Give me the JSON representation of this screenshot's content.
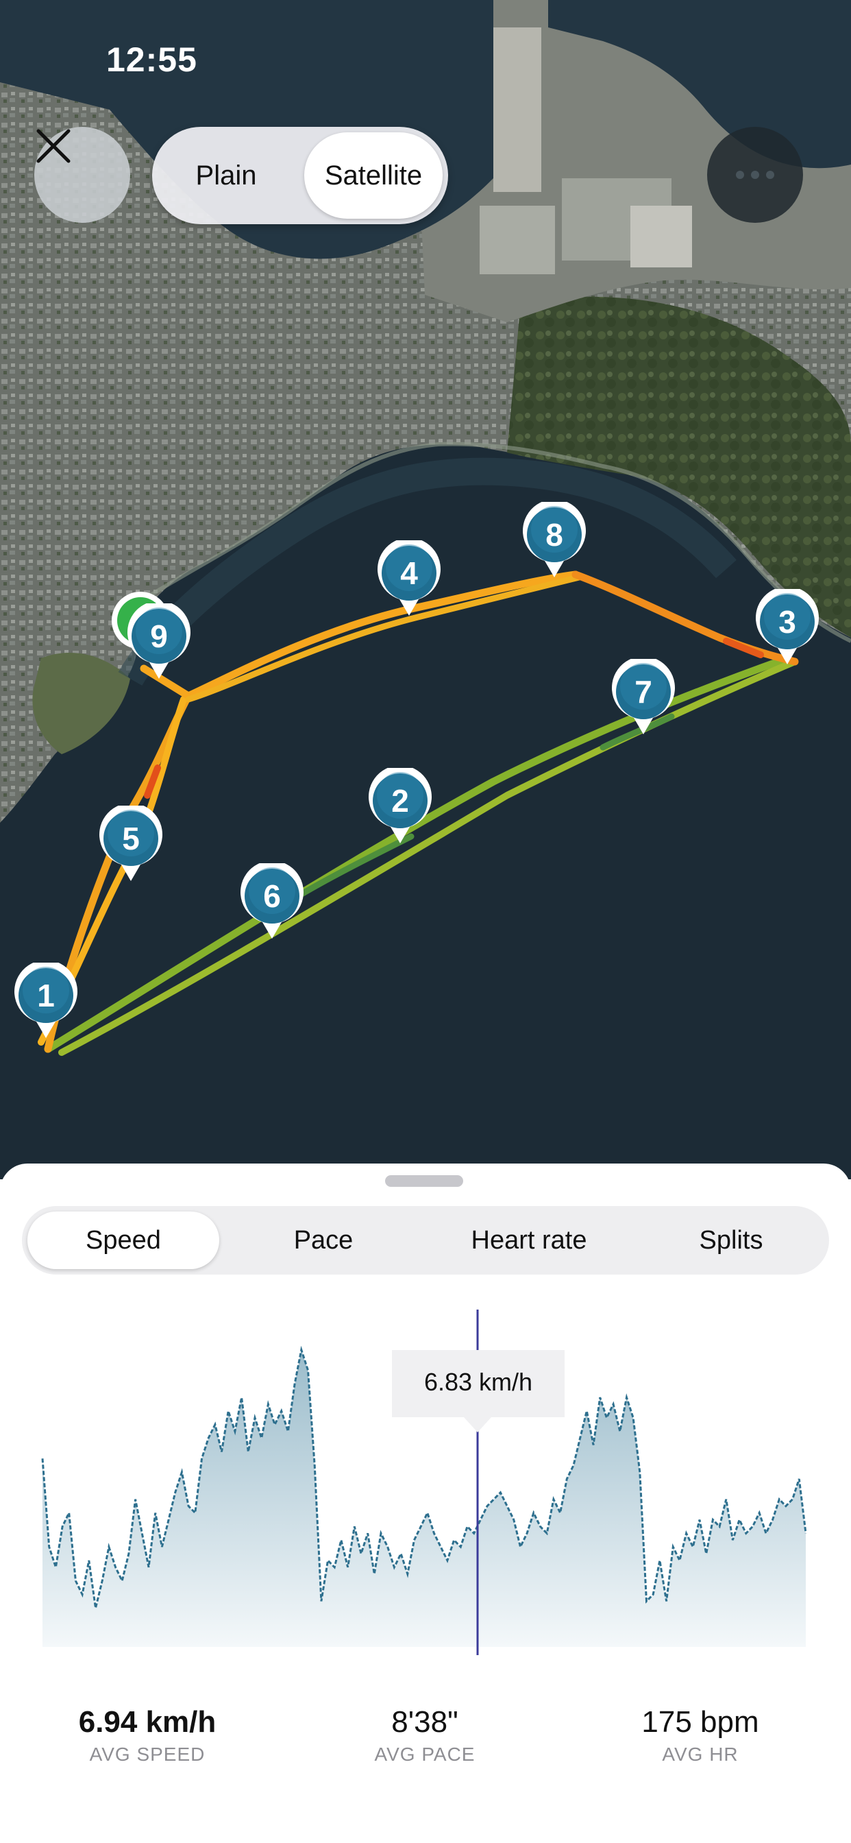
{
  "status_bar": {
    "time": "12:55"
  },
  "map_controls": {
    "close_icon": "close-x-icon",
    "view_toggle": {
      "options": [
        "Plain",
        "Satellite"
      ],
      "selected": "Satellite"
    },
    "more_icon": "more-dots-icon"
  },
  "route_markers": [
    "1",
    "2",
    "3",
    "4",
    "5",
    "6",
    "7",
    "8",
    "9"
  ],
  "tabs": {
    "items": [
      "Speed",
      "Pace",
      "Heart rate",
      "Splits"
    ],
    "selected": "Speed"
  },
  "tooltip": {
    "text": "6.83 km/h"
  },
  "stats": [
    {
      "value": "6.94 km/h",
      "label": "AVG SPEED"
    },
    {
      "value": "8'38\"",
      "label": "AVG PACE"
    },
    {
      "value": "175 bpm",
      "label": "AVG HR"
    }
  ],
  "colors": {
    "series_line": "#2d6f8e",
    "cursor": "#3b3b9a",
    "marker": "#1f6e91",
    "route_fast": "#f5b41e",
    "route_slow": "#8bb82c"
  },
  "chart_data": {
    "type": "area",
    "title": "",
    "xlabel": "",
    "ylabel": "",
    "series": [
      {
        "values": [
          7.5,
          6.2,
          5.9,
          6.5,
          6.7,
          5.7,
          5.5,
          6.0,
          5.3,
          5.7,
          6.2,
          5.9,
          5.7,
          6.1,
          6.9,
          6.4,
          5.9,
          6.7,
          6.2,
          6.6,
          7.0,
          7.3,
          6.8,
          6.7,
          7.5,
          7.8,
          8.0,
          7.6,
          8.2,
          7.9,
          8.4,
          7.6,
          8.1,
          7.8,
          8.3,
          8.0,
          8.2,
          7.9,
          8.6,
          9.1,
          8.8,
          7.4,
          5.4,
          6.0,
          5.9,
          6.3,
          5.9,
          6.5,
          6.1,
          6.4,
          5.8,
          6.4,
          6.2,
          5.9,
          6.1,
          5.8,
          6.3,
          6.5,
          6.7,
          6.4,
          6.2,
          6.0,
          6.3,
          6.2,
          6.5,
          6.4,
          6.6,
          6.8,
          6.9,
          7.0,
          6.8,
          6.6,
          6.2,
          6.4,
          6.7,
          6.5,
          6.4,
          6.9,
          6.7,
          7.2,
          7.4,
          7.8,
          8.2,
          7.7,
          8.4,
          8.1,
          8.3,
          7.9,
          8.4,
          8.1,
          7.3,
          5.4,
          5.5,
          6.0,
          5.4,
          6.2,
          6.0,
          6.4,
          6.2,
          6.6,
          6.1,
          6.6,
          6.5,
          6.9,
          6.3,
          6.6,
          6.4,
          6.5,
          6.7,
          6.4,
          6.6,
          6.9,
          6.8,
          6.9,
          7.2,
          6.4
        ]
      }
    ],
    "cursor_value": 6.83,
    "grid": false,
    "legend": "none"
  }
}
